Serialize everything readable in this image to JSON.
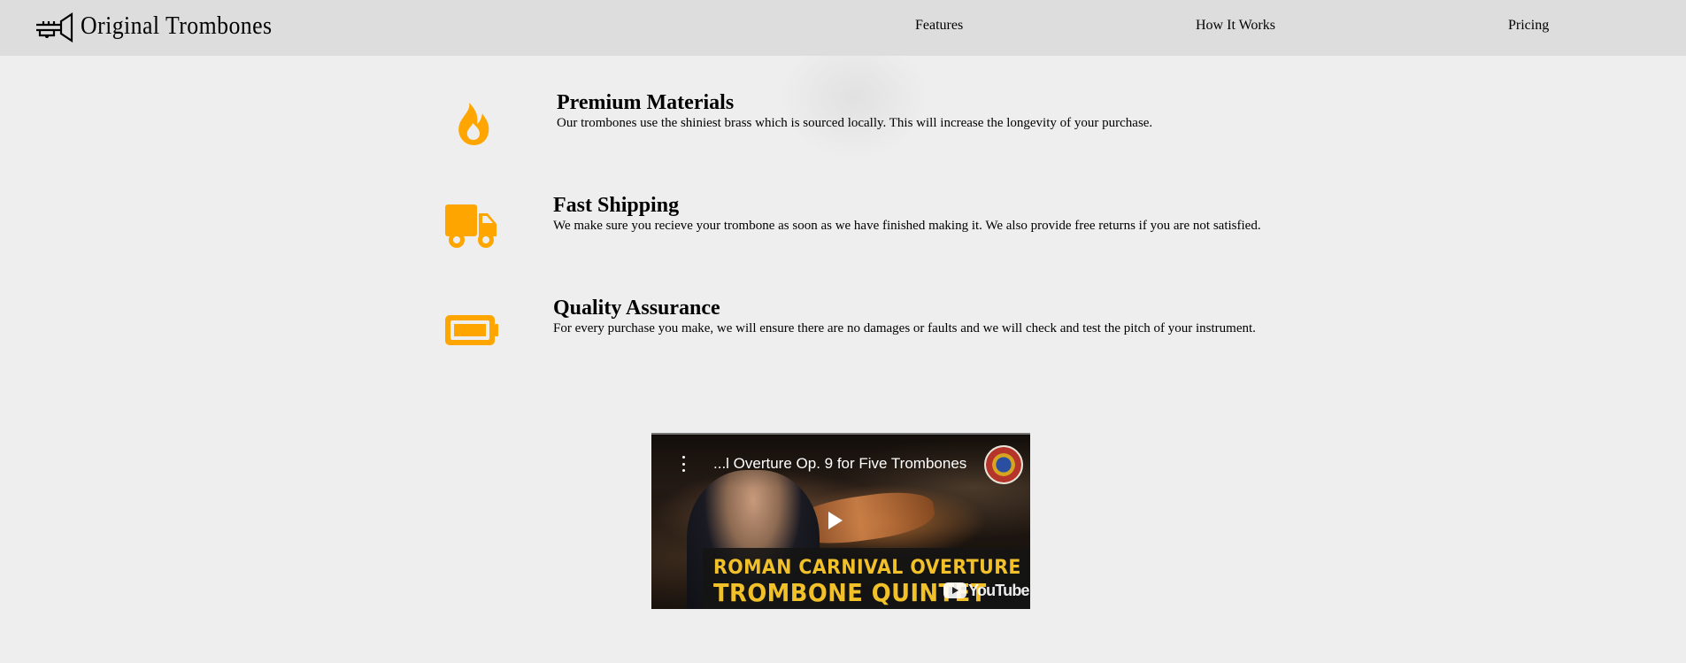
{
  "navbar": {
    "brand_name": "Original Trombones",
    "links": [
      "Features",
      "How It Works",
      "Pricing"
    ]
  },
  "features": [
    {
      "icon": "fire-icon",
      "title": "Premium Materials",
      "description": "Our trombones use the shiniest brass which is sourced locally. This will increase the longevity of your purchase."
    },
    {
      "icon": "truck-icon",
      "title": "Fast Shipping",
      "description": "We make sure you recieve your trombone as soon as we have finished making it. We also provide free returns if you are not satisfied."
    },
    {
      "icon": "battery-icon",
      "title": "Quality Assurance",
      "description": "For every purchase you make, we will ensure there are no damages or faults and we will check and test the pitch of your instrument."
    }
  ],
  "video": {
    "title": "...l Overture Op. 9 for Five Trombones",
    "banner_line1": "ROMAN CARNIVAL OVERTURE",
    "banner_line2": "TROMBONE QUINTET",
    "platform": "YouTube"
  },
  "colors": {
    "accent": "#ffa500",
    "navbar_bg": "#dddddd",
    "page_bg": "#eeeeee",
    "banner_text": "#f2c029"
  }
}
